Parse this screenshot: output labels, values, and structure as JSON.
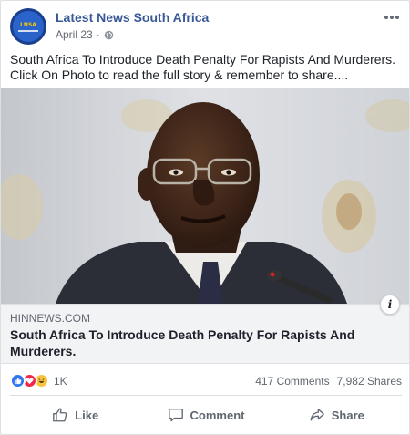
{
  "post": {
    "page_name": "Latest News South Africa",
    "date": "April 23",
    "separator": "·",
    "avatar_text": "LNSA",
    "text_line1": "South Africa To Introduce Death Penalty For Rapists And Murderers.",
    "text_line2": "Click On Photo to read the full story & remember to share...."
  },
  "link": {
    "domain": "HINNEWS.COM",
    "title": "South Africa To Introduce Death Penalty For Rapists And Murderers."
  },
  "reactions": {
    "icons": [
      "like-reaction",
      "love-reaction",
      "haha-reaction"
    ],
    "count": "1K",
    "comments": "417 Comments",
    "shares": "7,982 Shares"
  },
  "actions": {
    "like_label": "Like",
    "comment_label": "Comment",
    "share_label": "Share"
  },
  "colors": {
    "page_name": "#385898",
    "like_blue": "#2e75f2",
    "love_red": "#f0284a",
    "haha_yellow": "#f7c43c"
  }
}
